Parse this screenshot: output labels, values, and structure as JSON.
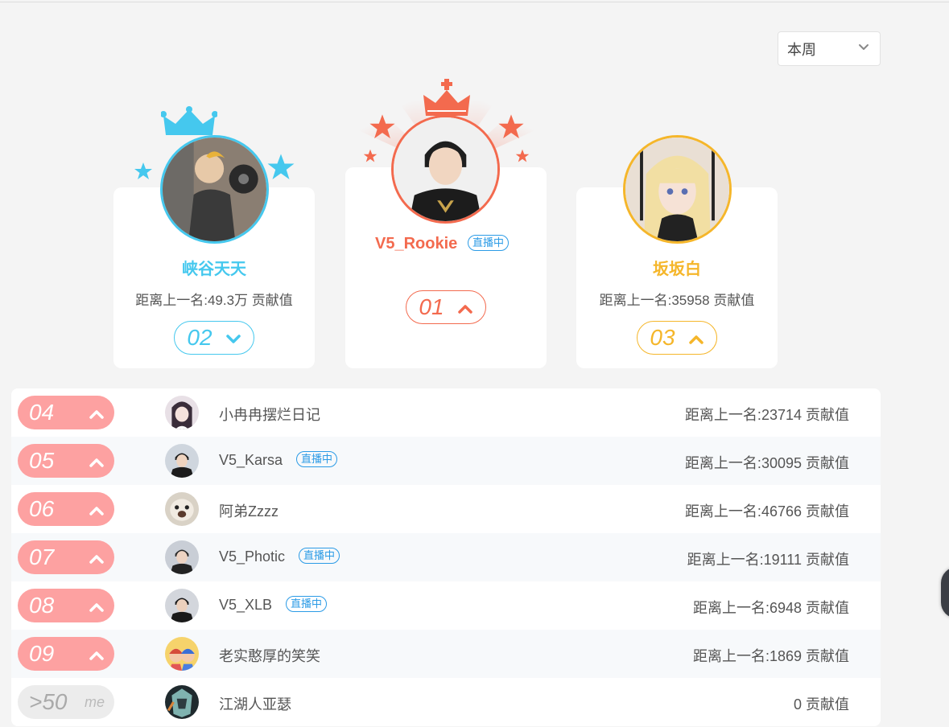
{
  "period_select": {
    "value": "本周"
  },
  "podium": [
    {
      "rank": "01",
      "name": "V5_Rookie",
      "live": "直播中",
      "trend": "up"
    },
    {
      "rank": "02",
      "name": "峡谷天天",
      "gap": "距离上一名:49.3万 贡献值",
      "trend": "down"
    },
    {
      "rank": "03",
      "name": "坂坂白",
      "gap": "距离上一名:35958 贡献值",
      "trend": "up"
    }
  ],
  "colors": {
    "first": "#f36a4e",
    "second": "#45c8ee",
    "third": "#f5b62a",
    "pill": "#fda1a1",
    "live": "#2b9be6"
  },
  "list": [
    {
      "rank": "04",
      "name": "小冉冉摆烂日记",
      "live": "",
      "gap": "距离上一名:23714 贡献值",
      "trend": "up"
    },
    {
      "rank": "05",
      "name": "V5_Karsa",
      "live": "直播中",
      "gap": "距离上一名:30095 贡献值",
      "trend": "up"
    },
    {
      "rank": "06",
      "name": "阿弟Zzzz",
      "live": "",
      "gap": "距离上一名:46766 贡献值",
      "trend": "up"
    },
    {
      "rank": "07",
      "name": "V5_Photic",
      "live": "直播中",
      "gap": "距离上一名:19111 贡献值",
      "trend": "up"
    },
    {
      "rank": "08",
      "name": "V5_XLB",
      "live": "直播中",
      "gap": "距离上一名:6948 贡献值",
      "trend": "up"
    },
    {
      "rank": "09",
      "name": "老实憨厚的笑笑",
      "live": "",
      "gap": "距离上一名:1869 贡献值",
      "trend": "up"
    }
  ],
  "me": {
    "rank": ">50",
    "tag": "me",
    "name": "江湖人亚瑟",
    "gap": "0 贡献值"
  },
  "icons": {
    "select_arrow": "chevron-down-icon",
    "up": "chevron-up-icon",
    "down": "chevron-down-icon",
    "crown": "crown-icon",
    "star": "star-icon"
  }
}
